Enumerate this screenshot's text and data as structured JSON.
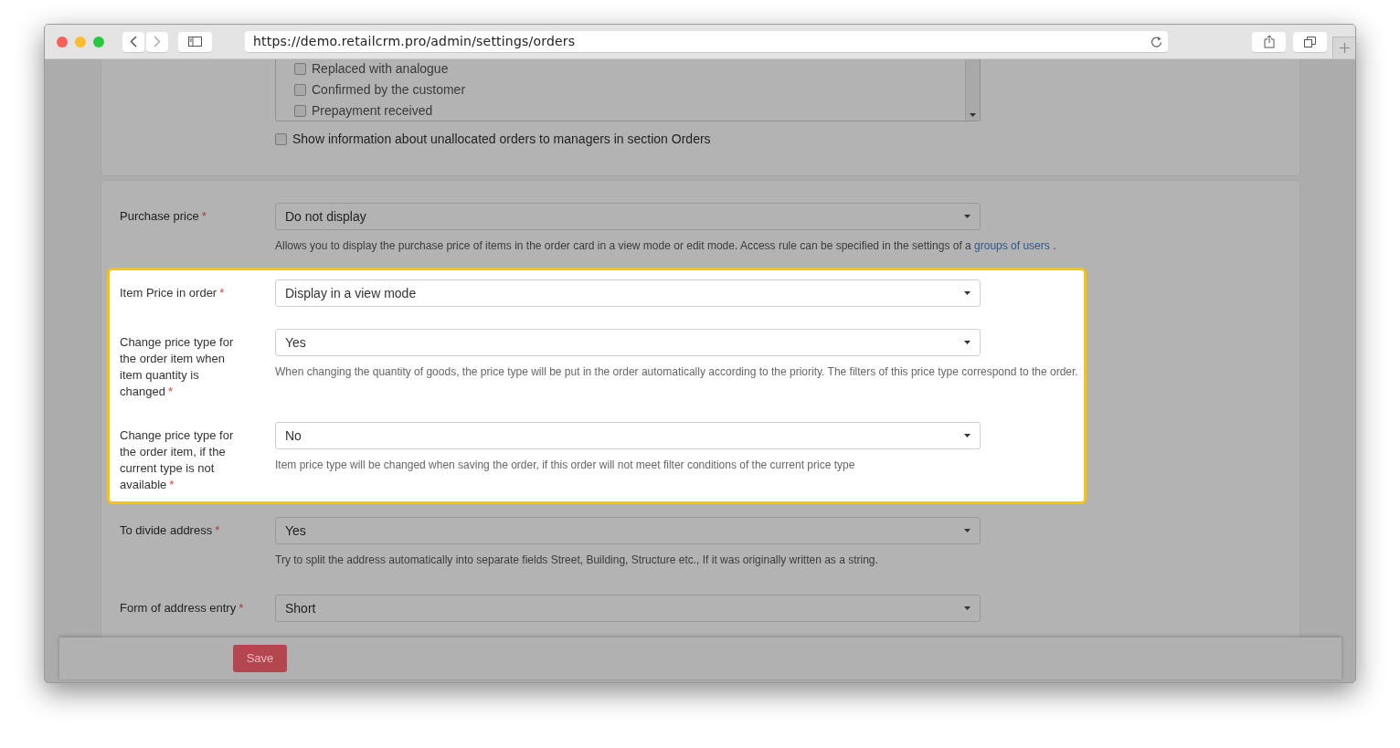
{
  "browser": {
    "url": "https://demo.retailcrm.pro/admin/settings/orders"
  },
  "status_checklist": [
    {
      "label": "Replaced with analogue",
      "checked": false
    },
    {
      "label": "Confirmed by the customer",
      "checked": false
    },
    {
      "label": "Prepayment received",
      "checked": false
    }
  ],
  "unallocated_option": {
    "label": "Show information about unallocated orders to managers in section Orders",
    "checked": false
  },
  "fields": [
    {
      "label": "Purchase price",
      "required": true,
      "value": "Do not display",
      "highlighted": false,
      "help": [
        {
          "kind": "text",
          "text": "Allows you to display the purchase price of items in the order card in a view mode or edit mode. Access rule can be specified in the settings of a "
        },
        {
          "kind": "link",
          "text": "groups of users"
        },
        {
          "kind": "text",
          "text": " ."
        }
      ]
    },
    {
      "label": "Item Price in order",
      "required": true,
      "value": "Display in a view mode",
      "highlighted": true
    },
    {
      "label": "Change price type for the order item when item quantity is changed",
      "required": true,
      "value": "Yes",
      "highlighted": true,
      "help": [
        {
          "kind": "text",
          "text": "When changing the quantity of goods, the price type will be put in the order automatically according to the priority. The filters of this price type correspond to the order."
        }
      ]
    },
    {
      "label": "Change price type for the order item, if the current type is not available",
      "required": true,
      "value": "No",
      "highlighted": true,
      "help": [
        {
          "kind": "text",
          "text": "Item price type will be changed when saving the order, if this order will not meet filter conditions of the current price type"
        }
      ]
    },
    {
      "label": "To divide address",
      "required": true,
      "value": "Yes",
      "highlighted": false,
      "help": [
        {
          "kind": "text",
          "text": "Try to split the address automatically into separate fields Street, Building, Structure etc., If it was originally written as a string."
        }
      ]
    },
    {
      "label": "Form of address entry",
      "required": true,
      "value": "Short",
      "highlighted": false
    }
  ],
  "required_mark": "*",
  "save_button": "Save"
}
